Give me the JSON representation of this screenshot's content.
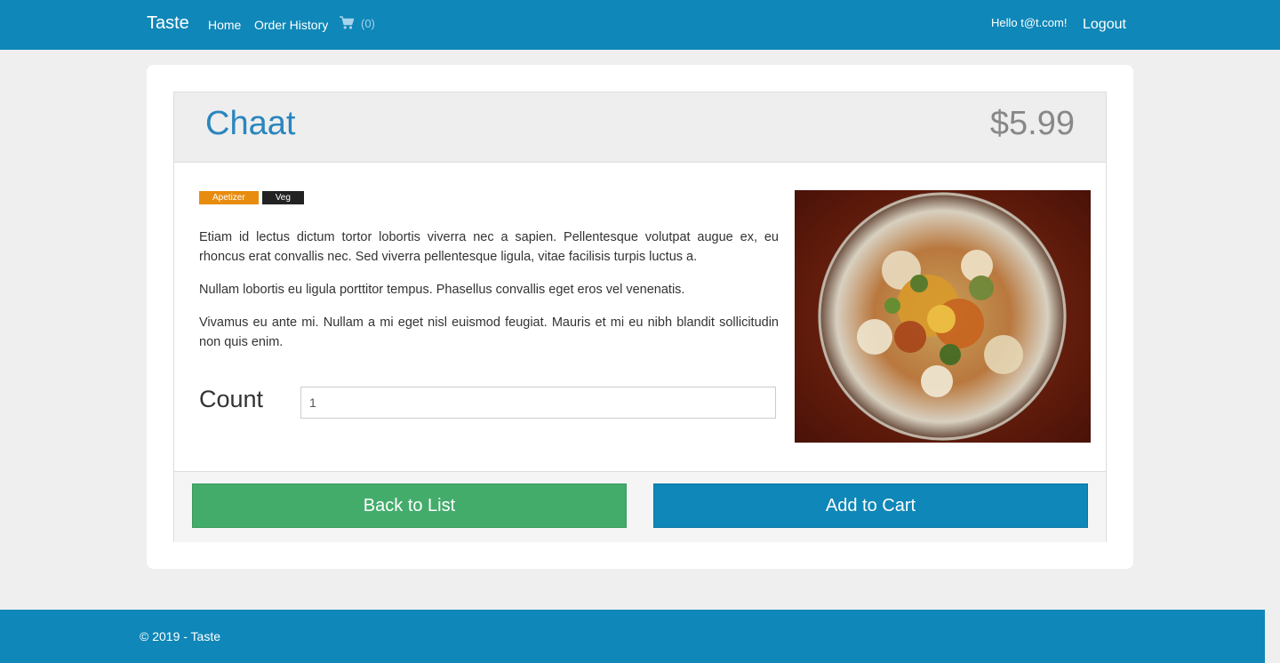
{
  "nav": {
    "brand": "Taste",
    "home": "Home",
    "order_history": "Order History",
    "cart_icon": "shopping-cart-icon",
    "cart_count": "(0)",
    "greeting": "Hello t@t.com!",
    "logout": "Logout"
  },
  "item": {
    "name": "Chaat",
    "price": "$5.99",
    "tags": [
      "Apetizer",
      "Veg"
    ],
    "description": [
      "Etiam id lectus dictum tortor lobortis viverra nec a sapien. Pellentesque volutpat augue ex, eu rhoncus erat convallis nec. Sed viverra pellentesque ligula, vitae facilisis turpis luctus a.",
      "Nullam lobortis eu ligula porttitor tempus. Phasellus convallis eget eros vel venenatis.",
      "Vivamus eu ante mi. Nullam a mi eget nisl euismod feugiat. Mauris et mi eu nibh blandit sollicitudin non quis enim."
    ],
    "count_label": "Count",
    "count_value": "1"
  },
  "actions": {
    "back": "Back to List",
    "add": "Add to Cart"
  },
  "footer": {
    "copyright": "© 2019 - Taste"
  },
  "colors": {
    "primary": "#0f87b8",
    "success": "#44ac6b",
    "tag_orange": "#e78c0f",
    "tag_black": "#222222"
  }
}
